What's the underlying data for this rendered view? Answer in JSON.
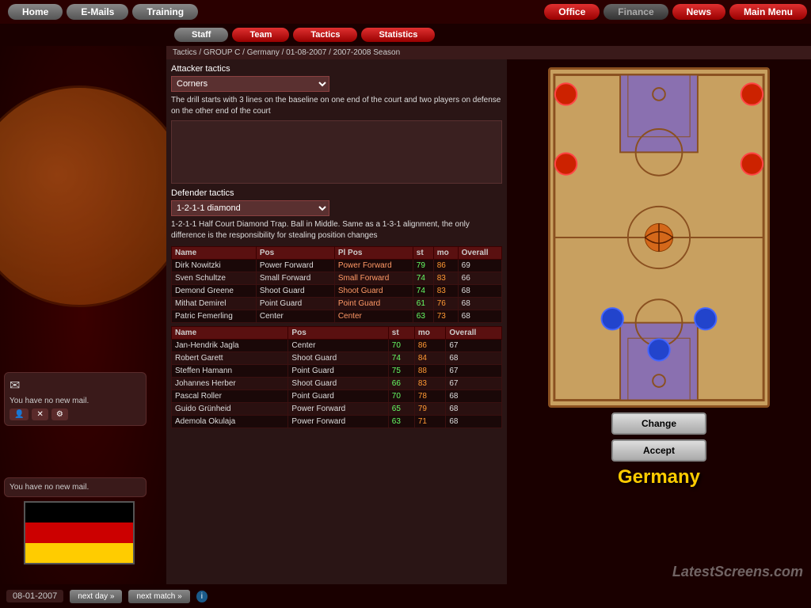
{
  "nav": {
    "top": {
      "left": [
        "Home",
        "E-Mails",
        "Training"
      ],
      "right_active": [
        "Office",
        "Finance",
        "News",
        "Main Menu"
      ]
    },
    "second": [
      "Staff",
      "Team",
      "Tactics",
      "Statistics"
    ],
    "tactics_active": "Tactics"
  },
  "breadcrumb": "Tactics / GROUP C / Germany / 01-08-2007 / 2007-2008 Season",
  "attacker": {
    "label": "Attacker tactics",
    "value": "Corners",
    "description": "The drill starts with 3 lines on the baseline on one end of the court and two players on defense on the other end of the court"
  },
  "defender": {
    "label": "Defender tactics",
    "value": "1-2-1-1 diamond",
    "description": "1-2-1-1 Half Court Diamond Trap. Ball in Middle. Same as a 1-3-1 alignment, the only difference is the responsibility for stealing position changes"
  },
  "attackers_header": [
    "Name",
    "Pos",
    "Pl Pos",
    "st",
    "mo",
    "Overall"
  ],
  "attackers": [
    {
      "name": "Dirk Nowitzki",
      "pos": "Power Forward",
      "plpos": "Power Forward",
      "st": "79",
      "mo": "86",
      "overall": "69"
    },
    {
      "name": "Sven Schultze",
      "pos": "Small Forward",
      "plpos": "Small Forward",
      "st": "74",
      "mo": "83",
      "overall": "66"
    },
    {
      "name": "Demond Greene",
      "pos": "Shoot Guard",
      "plpos": "Shoot Guard",
      "st": "74",
      "mo": "83",
      "overall": "68"
    },
    {
      "name": "Mithat Demirel",
      "pos": "Point Guard",
      "plpos": "Point Guard",
      "st": "61",
      "mo": "76",
      "overall": "68"
    },
    {
      "name": "Patric Femerling",
      "pos": "Center",
      "plpos": "Center",
      "st": "63",
      "mo": "73",
      "overall": "68"
    }
  ],
  "defenders_header": [
    "Name",
    "Pos",
    "st",
    "mo",
    "Overall"
  ],
  "defenders": [
    {
      "name": "Jan-Hendrik Jagla",
      "pos": "Center",
      "st": "70",
      "mo": "86",
      "overall": "67"
    },
    {
      "name": "Robert Garett",
      "pos": "Shoot Guard",
      "st": "74",
      "mo": "84",
      "overall": "68"
    },
    {
      "name": "Steffen Hamann",
      "pos": "Point Guard",
      "st": "75",
      "mo": "88",
      "overall": "67"
    },
    {
      "name": "Johannes Herber",
      "pos": "Shoot Guard",
      "st": "66",
      "mo": "83",
      "overall": "67"
    },
    {
      "name": "Pascal Roller",
      "pos": "Point Guard",
      "st": "70",
      "mo": "78",
      "overall": "68"
    },
    {
      "name": "Guido Grünheid",
      "pos": "Power Forward",
      "st": "65",
      "mo": "79",
      "overall": "68"
    },
    {
      "name": "Ademola Okulaja",
      "pos": "Power Forward",
      "st": "63",
      "mo": "71",
      "overall": "68"
    }
  ],
  "buttons": {
    "change": "Change",
    "accept": "Accept"
  },
  "country": "Germany",
  "mail": {
    "text1": "You have no new mail.",
    "text2": "You have no new mail."
  },
  "bottom": {
    "date": "08-01-2007",
    "next_day": "next day »",
    "next_match": "next match »"
  },
  "watermark": "LatestScreens.com"
}
